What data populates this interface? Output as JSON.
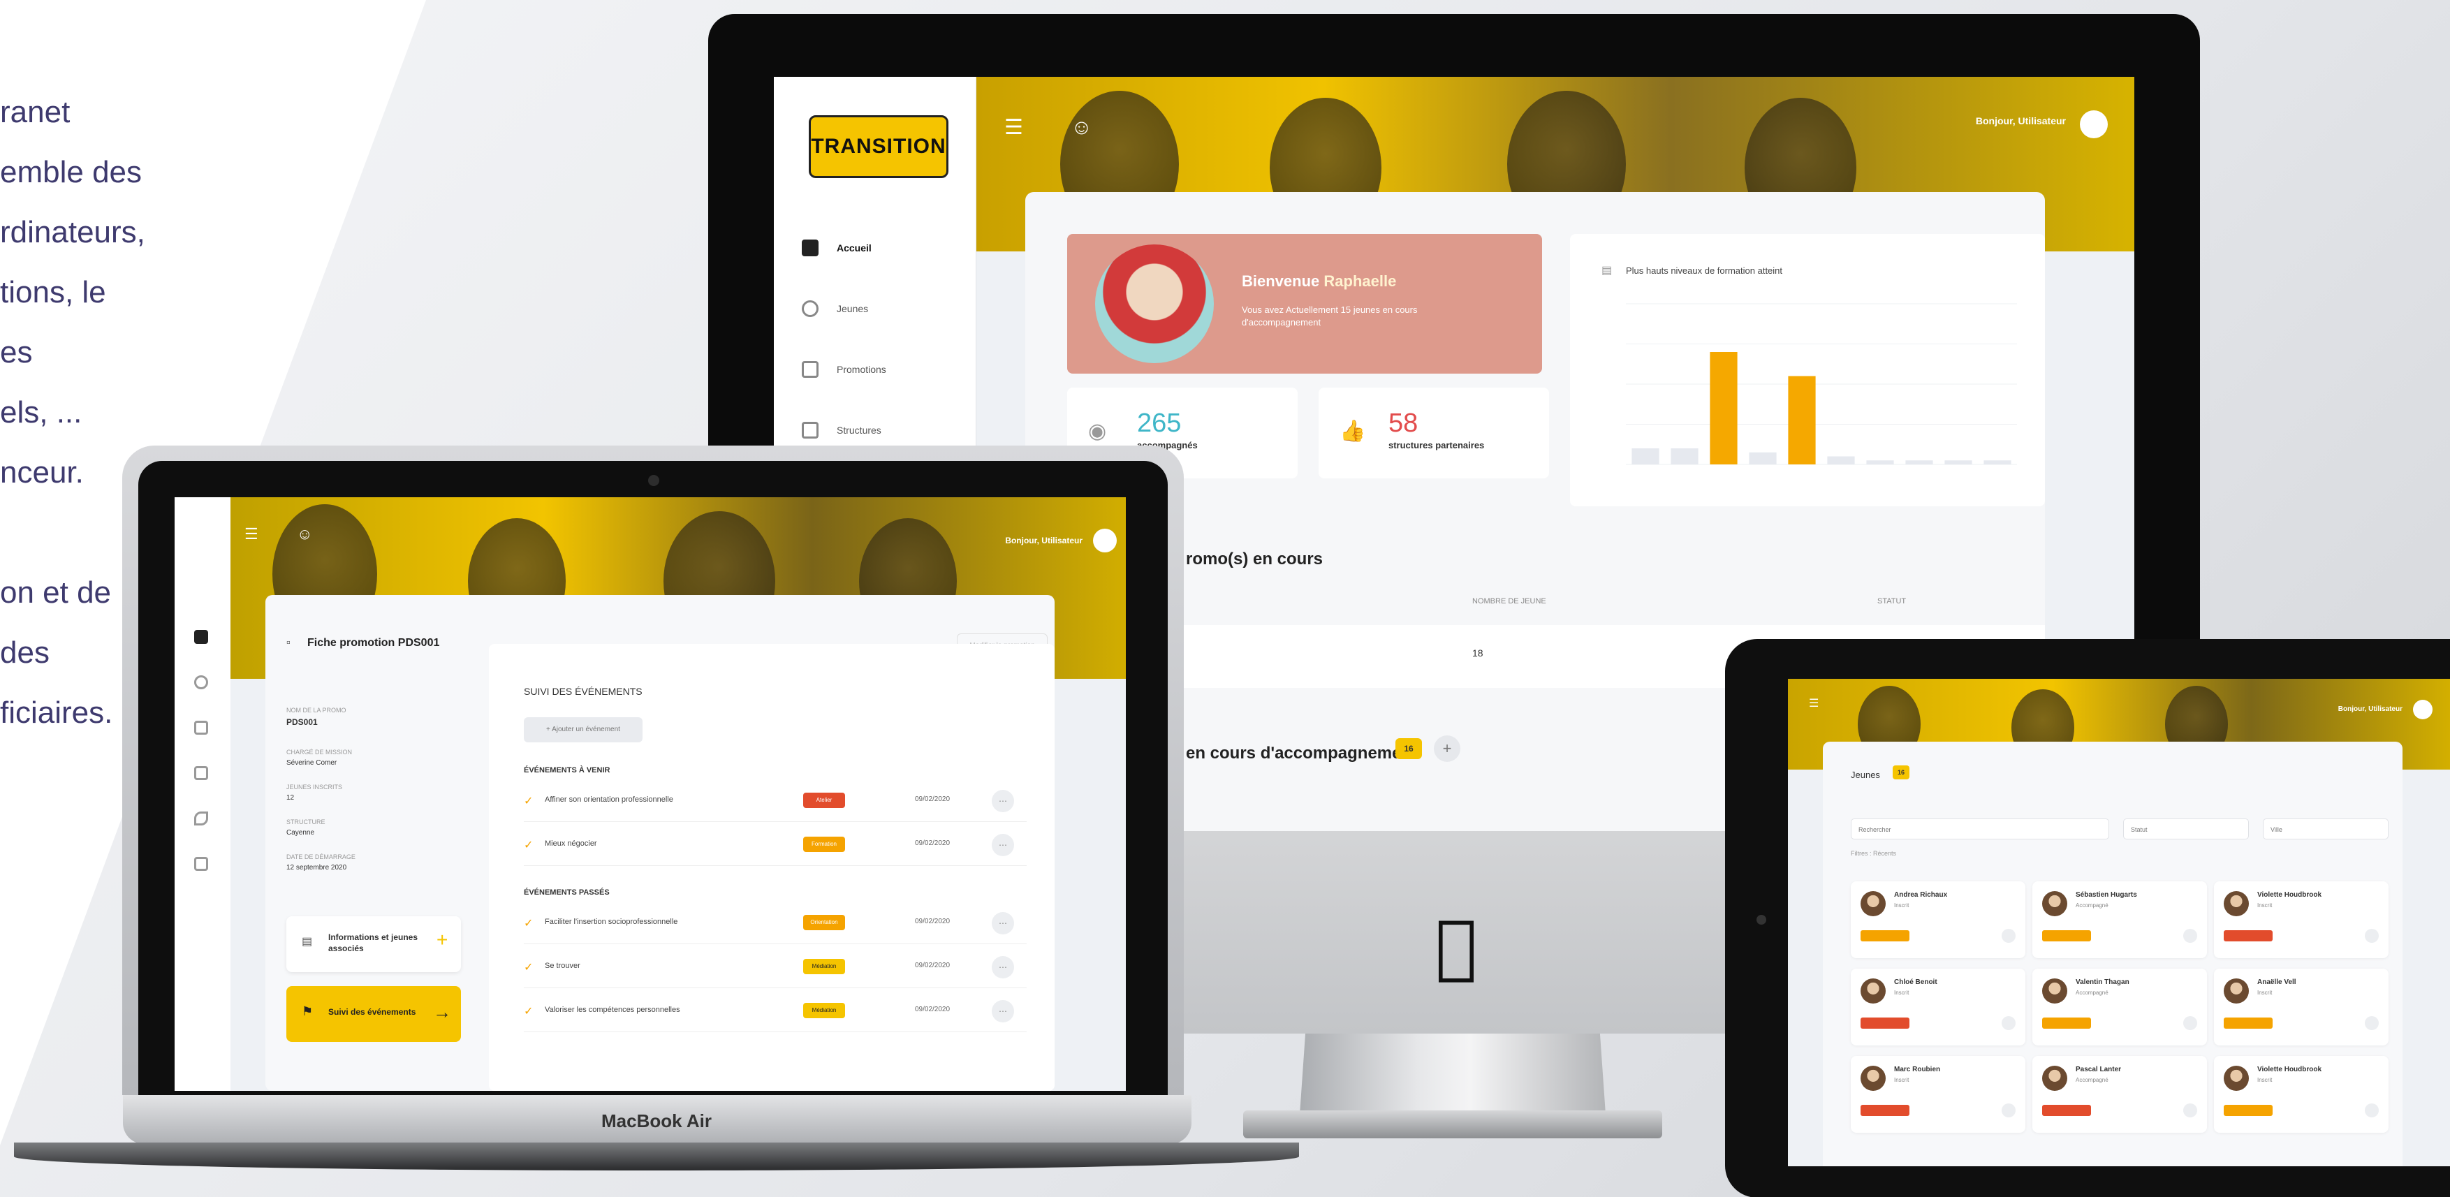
{
  "marketing_text": {
    "lines": [
      "ranet",
      "emble des",
      "rdinateurs,",
      "tions, le",
      "es",
      "els, ...",
      "nceur.",
      "",
      "on et de",
      "des",
      "ficiaires."
    ]
  },
  "imac": {
    "logo_text": "TRANSITION",
    "sidebar": {
      "items": [
        {
          "label": "Accueil",
          "active": true
        },
        {
          "label": "Jeunes"
        },
        {
          "label": "Promotions"
        },
        {
          "label": "Structures"
        }
      ]
    },
    "header": {
      "greeting": "Bonjour, Utilisateur"
    },
    "welcome": {
      "prefix": "Bienvenue",
      "name": "Raphaelle",
      "subtitle": "Vous avez Actuellement 15 jeunes en cours d'accompagnement"
    },
    "stats": [
      {
        "value": "265",
        "label": "accompagnés",
        "color": "#3fb6c8"
      },
      {
        "value": "58",
        "label": "structures partenaires",
        "color": "#e24c4c"
      }
    ],
    "promo_section": {
      "title": "romo(s) en cours",
      "col1": "NOMBRE DE JEUNE",
      "col2": "STATUT",
      "row_value": "18"
    },
    "jeunes_section": {
      "title": "en cours d'accompagnement",
      "badge": "16"
    }
  },
  "chart_data": {
    "type": "bar",
    "title": "Plus hauts niveaux de formation atteint",
    "categories": [
      "",
      "",
      "",
      "",
      "",
      "",
      "",
      "",
      "",
      ""
    ],
    "values": [
      20,
      20,
      140,
      15,
      110,
      10,
      5,
      5,
      5,
      5
    ],
    "highlighted": [
      false,
      false,
      true,
      false,
      true,
      false,
      false,
      false,
      false,
      false
    ],
    "ylim": [
      0,
      200
    ],
    "grid": true,
    "colors": {
      "normal": "#e6e9ef",
      "highlight": "#f5a800"
    }
  },
  "macbook": {
    "brand": "MacBook Air",
    "header": {
      "greeting": "Bonjour, Utilisateur"
    },
    "card_title": "Fiche promotion PDS001",
    "card_button": "Modifier la promotion",
    "fields": [
      {
        "label": "NOM DE LA PROMO",
        "value": "PDS001"
      },
      {
        "label": "CHARGÉ DE MISSION",
        "value": "Séverine Comer"
      },
      {
        "label": "JEUNES INSCRITS",
        "value": "12"
      },
      {
        "label": "STRUCTURE",
        "value": "Cayenne"
      },
      {
        "label": "DATE DE DÉMARRAGE",
        "value": "12 septembre 2020"
      }
    ],
    "info_button": "Informations et jeunes associés",
    "suivi_button": "Suivi des événements",
    "panel": {
      "title": "SUIVI DES ÉVÉNEMENTS",
      "add_button": "+ Ajouter un événement",
      "upcoming_label": "ÉVÉNEMENTS À VENIR",
      "past_label": "ÉVÉNEMENTS PASSÉS",
      "upcoming": [
        {
          "label": "Affiner son orientation professionnelle",
          "tag": "Atelier",
          "tag_color": "#e24c2c",
          "date": "09/02/2020"
        },
        {
          "label": "Mieux négocier",
          "tag": "Formation",
          "tag_color": "#f5a300",
          "date": "09/02/2020"
        }
      ],
      "past": [
        {
          "label": "Faciliter l'insertion socioprofessionnelle",
          "tag": "Orientation",
          "tag_color": "#f5a300",
          "date": "09/02/2020"
        },
        {
          "label": "Se trouver",
          "tag": "Médiation",
          "tag_color": "#f5c400",
          "date": "09/02/2020"
        },
        {
          "label": "Valoriser les compétences personnelles",
          "tag": "Médiation",
          "tag_color": "#f5c400",
          "date": "09/02/2020"
        }
      ]
    }
  },
  "ipad": {
    "header": {
      "greeting": "Bonjour, Utilisateur"
    },
    "title": "Jeunes",
    "badge": "16",
    "selects": [
      "Rechercher",
      "Statut",
      "Ville"
    ],
    "filter_label": "Filtres : Récents",
    "cards": [
      {
        "name": "Andrea Richaux",
        "status": "Inscrit"
      },
      {
        "name": "Sébastien Hugarts",
        "status": "Accompagné"
      },
      {
        "name": "Violette Houdbrook",
        "status": "Inscrit"
      },
      {
        "name": "Chloé Benoit",
        "status": "Inscrit"
      },
      {
        "name": "Valentin Thagan",
        "status": "Accompagné"
      },
      {
        "name": "Anaëlle Vell",
        "status": "Inscrit"
      },
      {
        "name": "Marc Roubien",
        "status": "Inscrit"
      },
      {
        "name": "Pascal Lanter",
        "status": "Accompagné"
      },
      {
        "name": "Violette Houdbrook",
        "status": "Inscrit"
      }
    ]
  }
}
